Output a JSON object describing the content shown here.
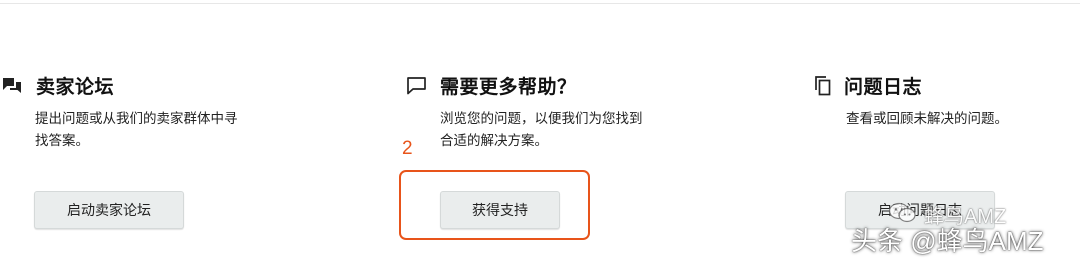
{
  "sections": [
    {
      "title": "卖家论坛",
      "icon": "chat-bubbles-icon",
      "description": "提出问题或从我们的卖家群体中寻\n找答案。",
      "button_label": "启动卖家论坛"
    },
    {
      "title": "需要更多帮助？",
      "icon": "chat-bubble-outline-icon",
      "description": "浏览您的问题，以便我们为您找到\n合适的解决方案。",
      "button_label": "获得支持"
    },
    {
      "title": "问题日志",
      "icon": "copy-document-icon",
      "description": "查看或回顾未解决的问题。",
      "button_label": "启动问题日志"
    }
  ],
  "annotation": {
    "number": "2",
    "color": "#e8541a"
  },
  "watermarks": {
    "middle": "蜂鸟AMZ",
    "bottom": "头条 @蜂鸟AMZ"
  }
}
